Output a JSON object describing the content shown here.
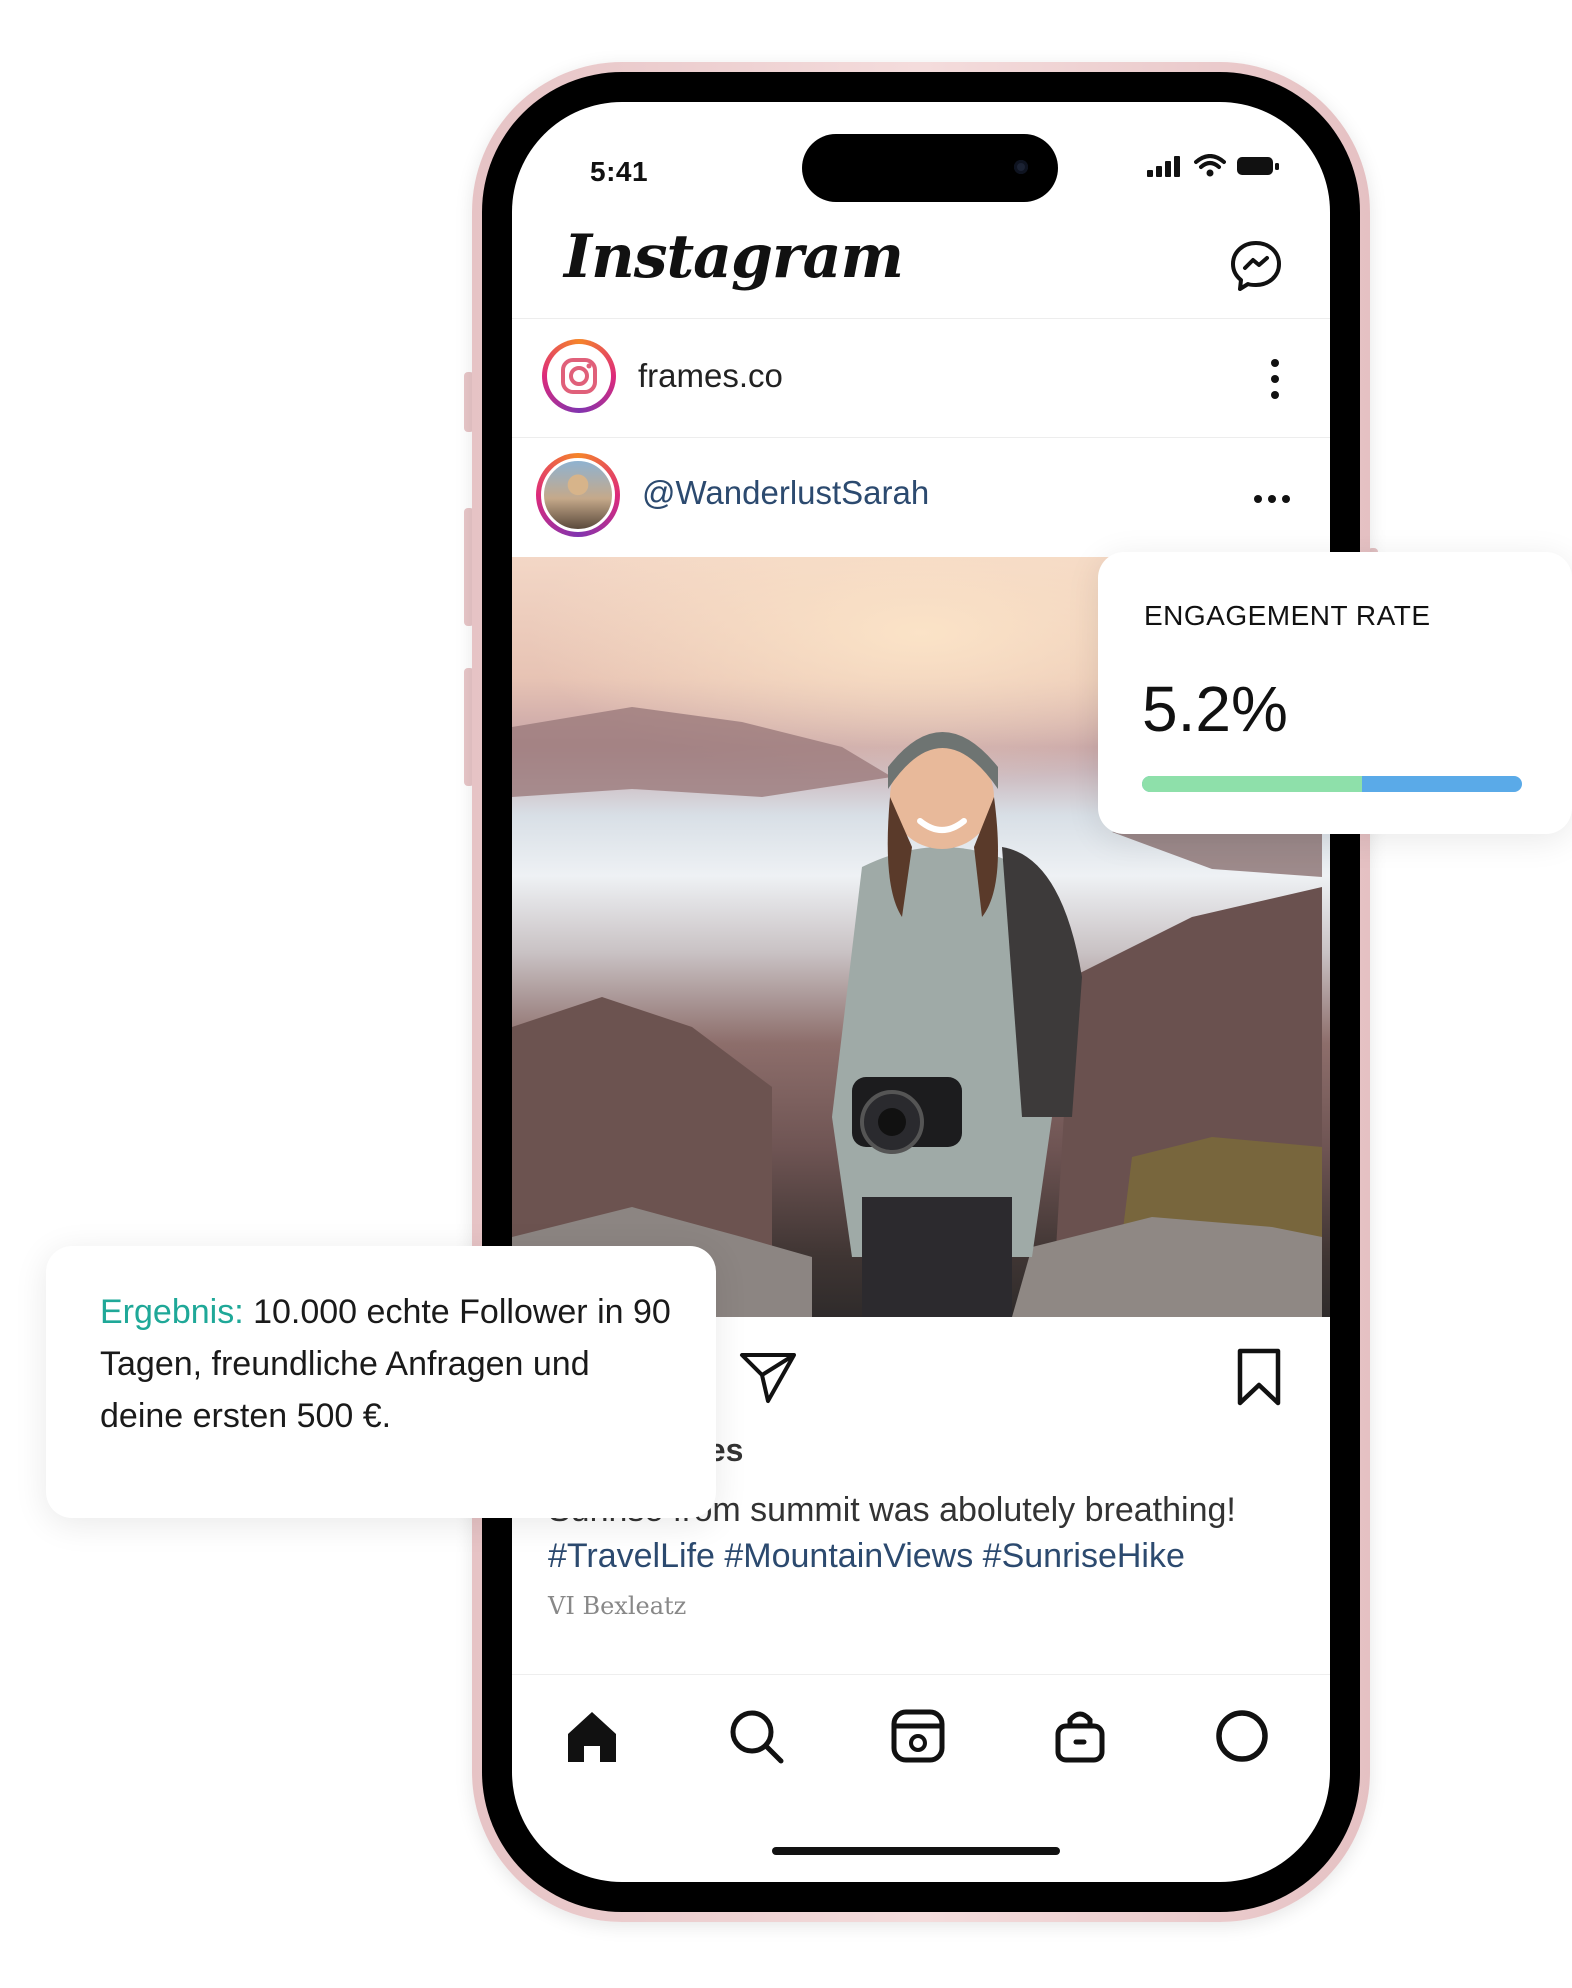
{
  "status_bar": {
    "time": "5:41"
  },
  "header": {
    "logo": "Instagram",
    "messenger_icon": "messenger-icon"
  },
  "account_row": {
    "username": "frames.co",
    "menu_icon": "kebab-menu-icon"
  },
  "post": {
    "author": "@WanderlustSarah",
    "menu_icon": "more-dots-icon",
    "likes_fragment": "kes",
    "caption": "Sunrise from summit was abolutely breathing!",
    "hashtags": "#TravelLife #MountainViews #SunriseHike",
    "meta": "VI Bexleatz"
  },
  "bottom_nav": [
    "home-icon",
    "search-icon",
    "reels-icon",
    "shop-icon",
    "profile-icon"
  ],
  "engagement_card": {
    "label": "ENGAGEMENT RATE",
    "value": "5.2%",
    "bar_fill_fraction": 0.58,
    "colors": {
      "fill": "#8ee0aa",
      "track": "#5aaae8"
    }
  },
  "result_card": {
    "accent": "Ergebnis:",
    "text": "10.000 echte Follower in 90 Tagen, freundliche Anfragen und deine ersten 500 €.",
    "accent_color": "#1fa898"
  }
}
